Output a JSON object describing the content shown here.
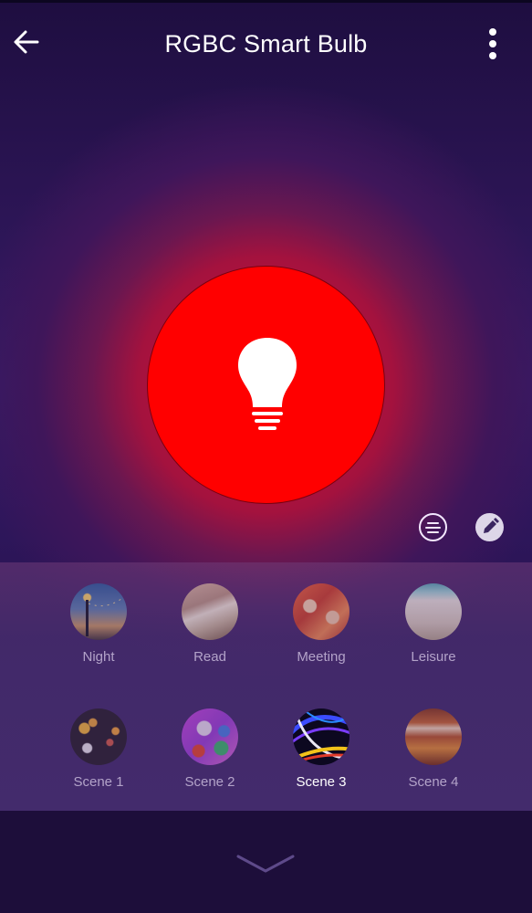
{
  "appbar": {
    "title": "RGBC Smart Bulb",
    "back_icon": "arrow-left-icon",
    "menu_icon": "more-vertical-icon"
  },
  "bulb": {
    "state": "on",
    "color": "#ff0000",
    "icon": "lightbulb-icon"
  },
  "actions": {
    "list_icon": "list-icon",
    "edit_icon": "pencil-icon"
  },
  "scenes": {
    "selected": "Scene 3",
    "items": [
      {
        "label": "Night",
        "image": "street-lamp-dusk"
      },
      {
        "label": "Read",
        "image": "open-book"
      },
      {
        "label": "Meeting",
        "image": "people-toasting"
      },
      {
        "label": "Leisure",
        "image": "beach"
      },
      {
        "label": "Scene 1",
        "image": "bokeh-lights"
      },
      {
        "label": "Scene 2",
        "image": "colorful-paint-splatter"
      },
      {
        "label": "Scene 3",
        "image": "neon-light-streaks"
      },
      {
        "label": "Scene 4",
        "image": "blurred-orange-lights"
      }
    ]
  },
  "footer": {
    "expand_icon": "chevron-down-icon"
  },
  "colors": {
    "background": "#2a1452",
    "accent_bulb": "#ff0000",
    "panel": "#432b6c",
    "footer": "#1d0e3a"
  }
}
